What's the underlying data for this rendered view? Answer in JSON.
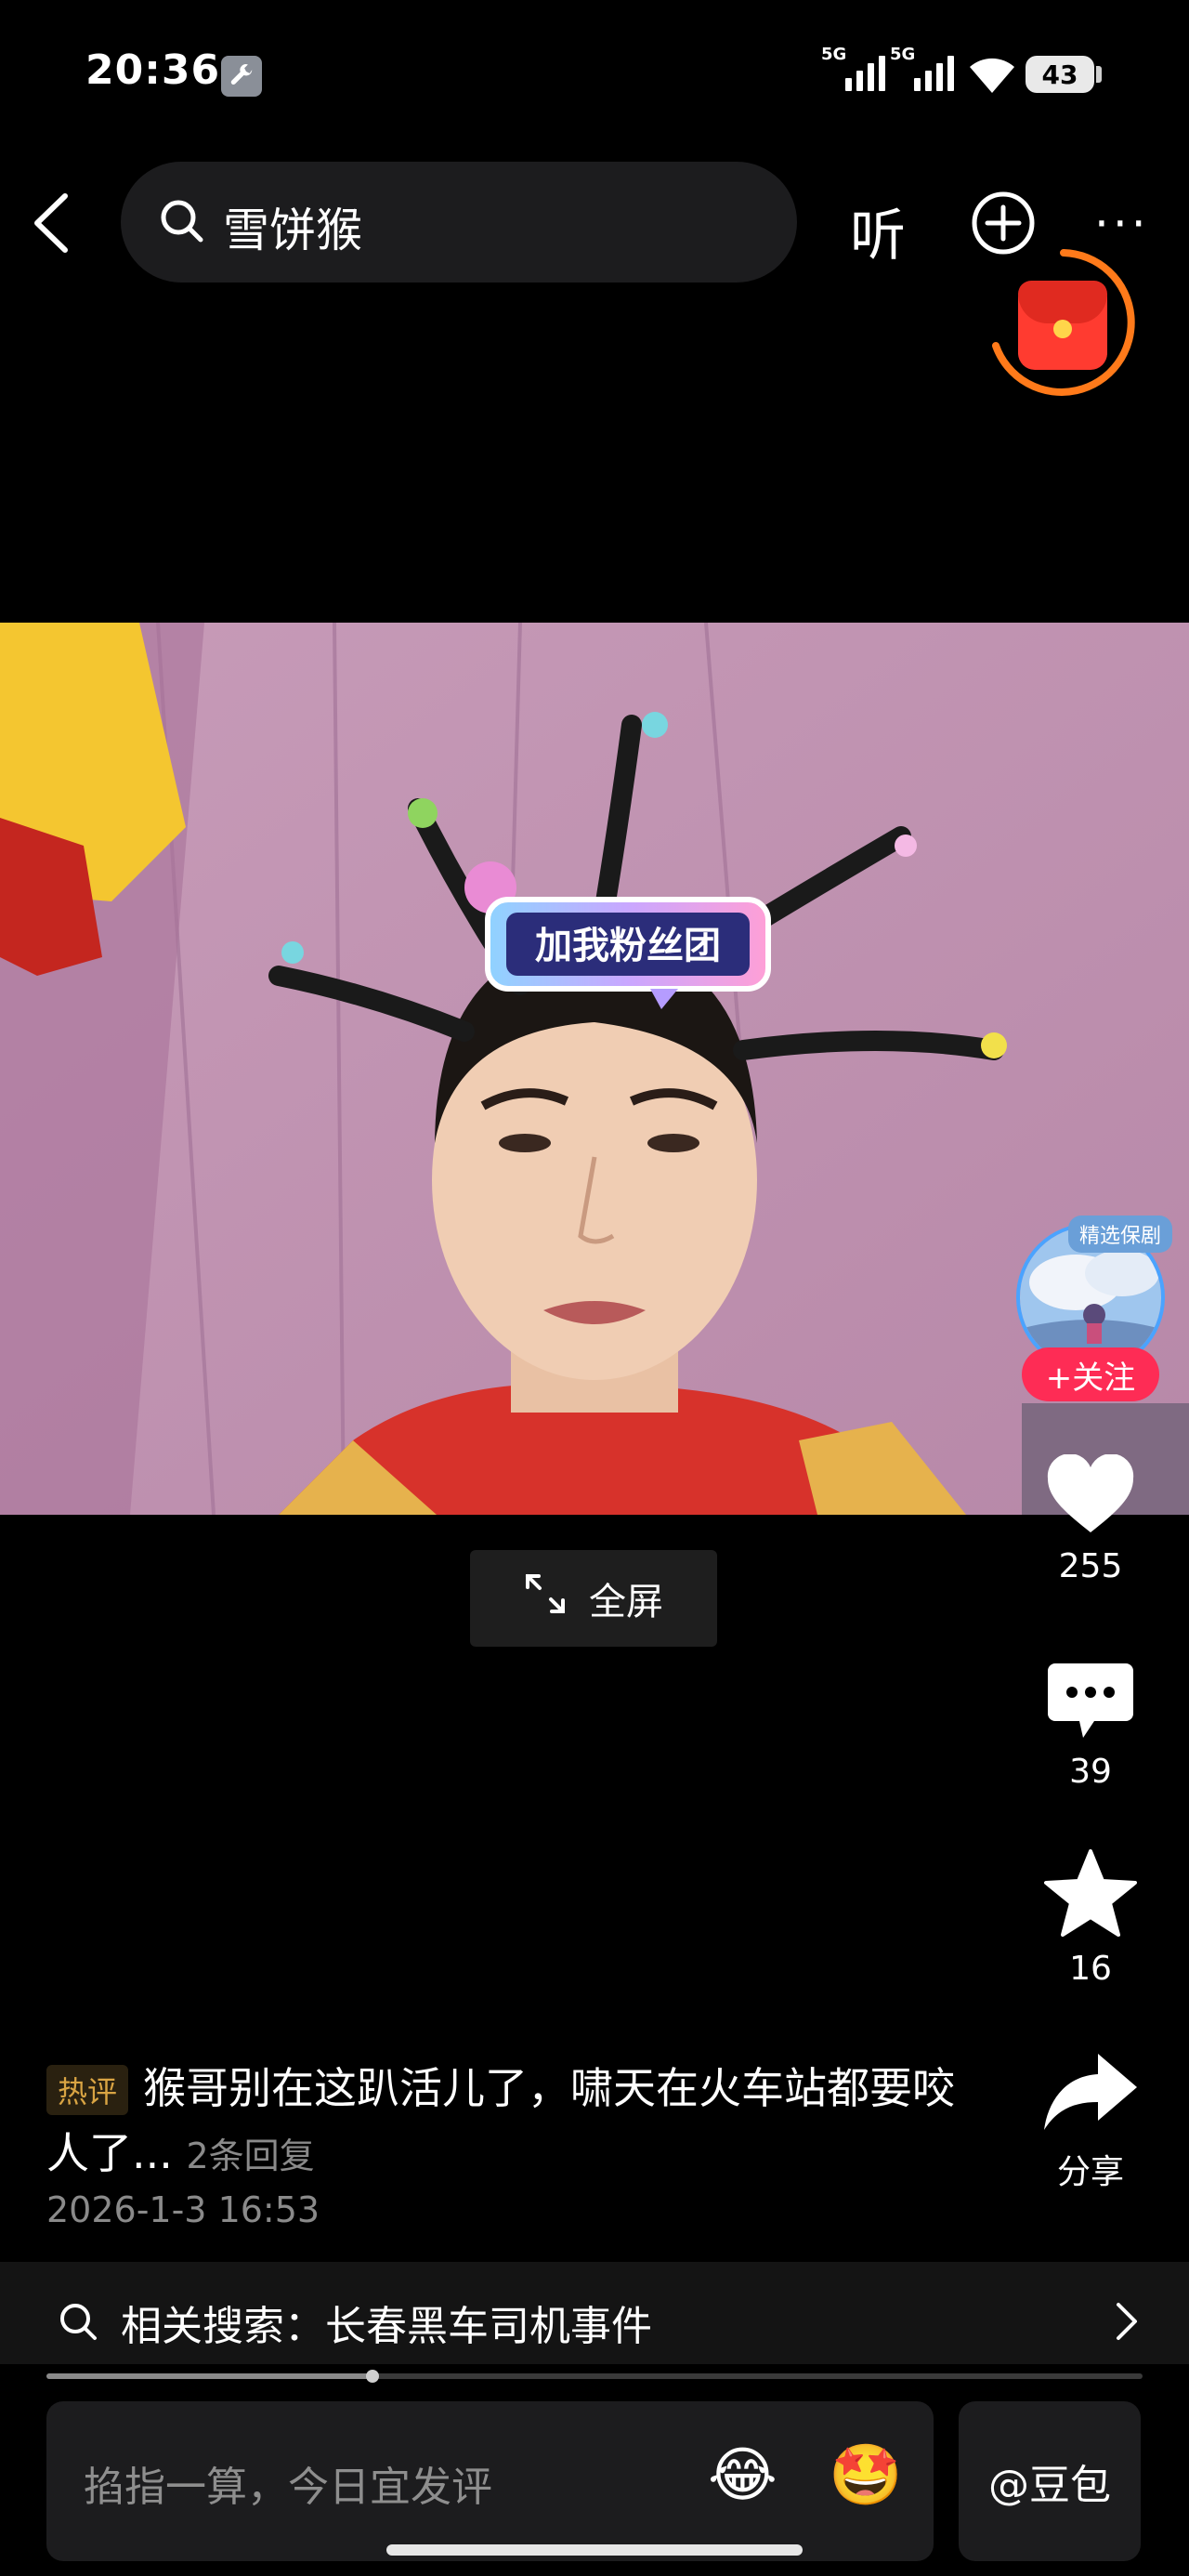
{
  "status_bar": {
    "time": "20:36",
    "sim1": "5G",
    "sim2": "5G",
    "battery": "43"
  },
  "header": {
    "search_query": "雪饼猴",
    "listen_label": "听"
  },
  "video": {
    "sticker_text": "加我粉丝团",
    "fullscreen_label": "全屏"
  },
  "author": {
    "badge": "精选保剧",
    "follow_label": "+关注"
  },
  "actions": {
    "likes": "255",
    "comments": "39",
    "favorites": "16",
    "share_label": "分享"
  },
  "hot_comment": {
    "tag": "热评",
    "text": "猴哥别在这趴活儿了，啸天在火车站都要咬人了...",
    "replies": "2条回复",
    "date": "2026-1-3 16:53"
  },
  "related_search": {
    "label": "相关搜索：长春黑车司机事件"
  },
  "comment_bar": {
    "placeholder": "掐指一算，今日宜发评",
    "emoji1": "😂",
    "emoji2": "🤩",
    "doubao_label": "@豆包"
  },
  "colors": {
    "accent": "#fe2c55",
    "ring": "#ff7a1a",
    "hot_tag": "#d9a443"
  }
}
